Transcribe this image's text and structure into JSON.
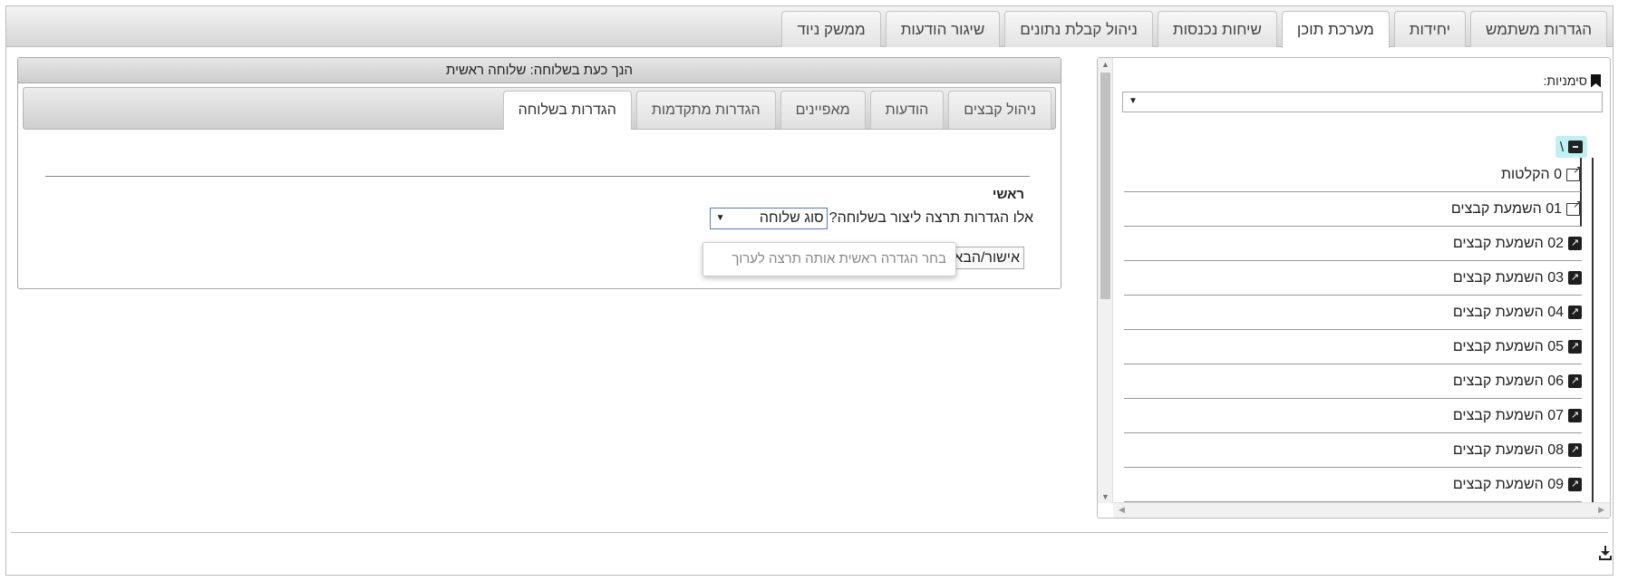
{
  "top_tabs": [
    {
      "label": "הגדרות משתמש"
    },
    {
      "label": "יחידות"
    },
    {
      "label": "מערכת תוכן"
    },
    {
      "label": "שיחות נכנסות"
    },
    {
      "label": "ניהול קבלת נתונים"
    },
    {
      "label": "שיגור הודעות"
    },
    {
      "label": "ממשק ניוד"
    }
  ],
  "bookmarks": {
    "label": "סימניות:",
    "selected": ""
  },
  "tree": {
    "root": "\\",
    "items": [
      {
        "label": "0 הקלטות",
        "icon": "external-link-icon"
      },
      {
        "label": "01 השמעת קבצים",
        "icon": "external-link-icon"
      },
      {
        "label": "02 השמעת קבצים",
        "icon": "shortcut-icon"
      },
      {
        "label": "03 השמעת קבצים",
        "icon": "shortcut-icon"
      },
      {
        "label": "04 השמעת קבצים",
        "icon": "shortcut-icon"
      },
      {
        "label": "05 השמעת קבצים",
        "icon": "shortcut-icon"
      },
      {
        "label": "06 השמעת קבצים",
        "icon": "shortcut-icon"
      },
      {
        "label": "07 השמעת קבצים",
        "icon": "shortcut-icon"
      },
      {
        "label": "08 השמעת קבצים",
        "icon": "shortcut-icon"
      },
      {
        "label": "09 השמעת קבצים",
        "icon": "shortcut-icon"
      }
    ]
  },
  "extension_panel": {
    "title": "הנך כעת בשלוחה: שלוחה ראשית",
    "tabs": [
      {
        "label": "ניהול קבצים"
      },
      {
        "label": "הודעות"
      },
      {
        "label": "מאפיינים"
      },
      {
        "label": "הגדרות מתקדמות"
      },
      {
        "label": "הגדרות בשלוחה"
      }
    ],
    "section_title": "ראשי",
    "question": "אלו הגדרות תרצה ליצור בשלוחה?",
    "type_select_value": "סוג שלוחה",
    "confirm_label": "אישור/הבאת",
    "tooltip": "בחר הגדרה ראשית אותה תרצה לערוך"
  },
  "colors": {
    "root_highlight": "#bff0f2",
    "select_border": "#4a7bd0"
  }
}
